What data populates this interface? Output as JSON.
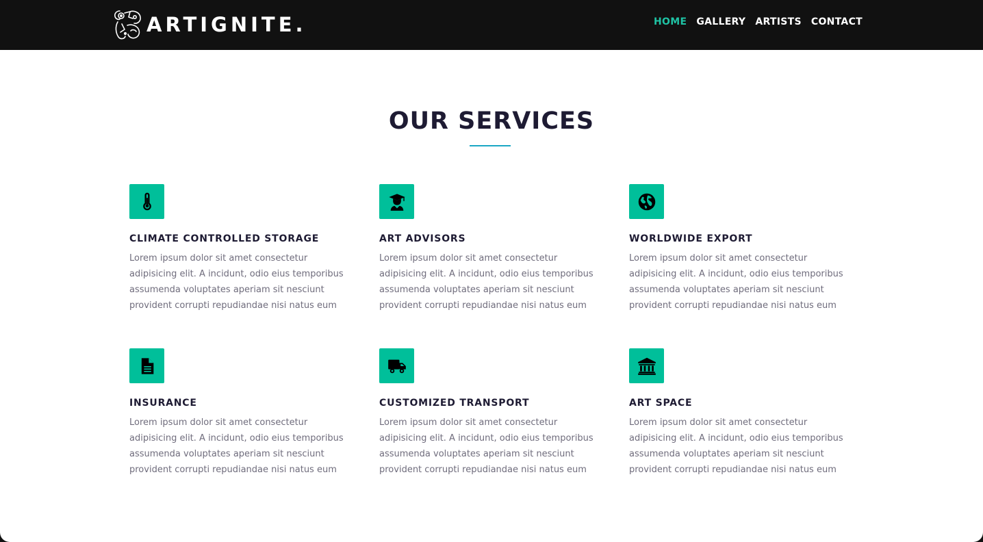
{
  "header": {
    "brand": "ARTIGNITE.",
    "nav": [
      "HOME",
      "GALLERY",
      "ARTISTS",
      "CONTACT"
    ],
    "active_nav": "HOME"
  },
  "services": {
    "title": "OUR SERVICES",
    "items": [
      {
        "icon": "thermometer-icon",
        "title": "CLIMATE CONTROLLED STORAGE",
        "text": "Lorem ipsum dolor sit amet consectetur adipisicing elit. A incidunt, odio eius temporibus assumenda voluptates aperiam sit nesciunt provident corrupti repudiandae nisi natus eum"
      },
      {
        "icon": "graduate-icon",
        "title": "ART ADVISORS",
        "text": "Lorem ipsum dolor sit amet consectetur adipisicing elit. A incidunt, odio eius temporibus assumenda voluptates aperiam sit nesciunt provident corrupti repudiandae nisi natus eum"
      },
      {
        "icon": "globe-icon",
        "title": "WORLDWIDE EXPORT",
        "text": "Lorem ipsum dolor sit amet consectetur adipisicing elit. A incidunt, odio eius temporibus assumenda voluptates aperiam sit nesciunt provident corrupti repudiandae nisi natus eum"
      },
      {
        "icon": "document-icon",
        "title": "INSURANCE",
        "text": "Lorem ipsum dolor sit amet consectetur adipisicing elit. A incidunt, odio eius temporibus assumenda voluptates aperiam sit nesciunt provident corrupti repudiandae nisi natus eum"
      },
      {
        "icon": "truck-icon",
        "title": "CUSTOMIZED TRANSPORT",
        "text": "Lorem ipsum dolor sit amet consectetur adipisicing elit. A incidunt, odio eius temporibus assumenda voluptates aperiam sit nesciunt provident corrupti repudiandae nisi natus eum"
      },
      {
        "icon": "bank-icon",
        "title": "ART SPACE",
        "text": "Lorem ipsum dolor sit amet consectetur adipisicing elit. A incidunt, odio eius temporibus assumenda voluptates aperiam sit nesciunt provident corrupti repudiandae nisi natus eum"
      }
    ]
  },
  "colors": {
    "navbar": "#111111",
    "accent": "#1fc3a5",
    "icon_bg": "#00bf9a",
    "heading": "#1e1b33",
    "body_text": "#6f6c7c",
    "underline": "#1aa7c4"
  }
}
